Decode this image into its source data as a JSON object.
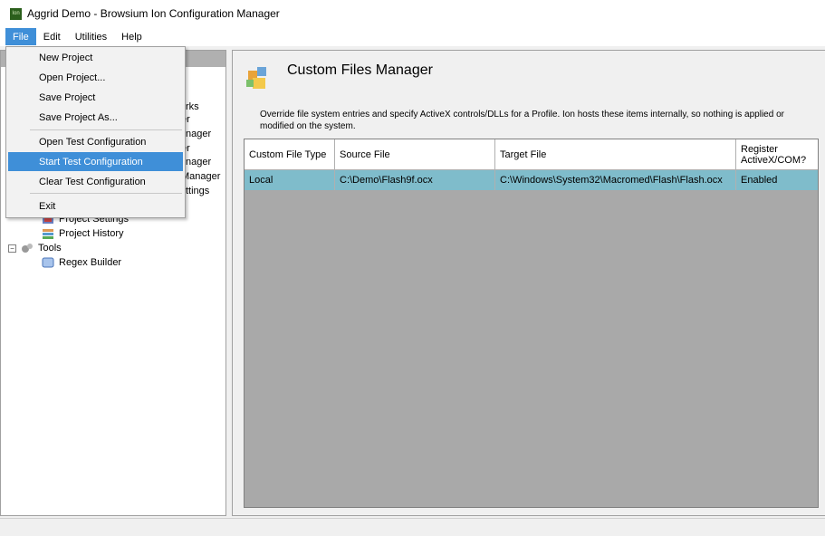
{
  "window": {
    "title": "Aggrid Demo - Browsium Ion Configuration Manager",
    "app_icon_text": "Ion"
  },
  "menubar": {
    "items": [
      "File",
      "Edit",
      "Utilities",
      "Help"
    ]
  },
  "file_menu": {
    "items": [
      "New Project",
      "Open Project...",
      "Save Project",
      "Save Project As...",
      "Open Test Configuration",
      "Start Test Configuration",
      "Clear Test Configuration",
      "Exit"
    ],
    "highlighted": "Start Test Configuration"
  },
  "tree": {
    "partial_labels": [
      "rks",
      "er",
      "nager",
      "er",
      "nager",
      "Manager",
      "ttings"
    ],
    "project_settings": "Project Settings",
    "project_history": "Project History",
    "tools": "Tools",
    "regex_builder": "Regex Builder"
  },
  "main": {
    "title": "Custom Files Manager",
    "description": "Override file system entries and specify ActiveX controls/DLLs for a Profile. Ion hosts these items internally, so nothing is applied or modified on the system.",
    "columns": [
      "Custom File Type",
      "Source File",
      "Target File",
      "Register ActiveX/COM?"
    ],
    "rows": [
      {
        "type": "Local",
        "source": "C:\\Demo\\Flash9f.ocx",
        "target": "C:\\Windows\\System32\\Macromed\\Flash\\Flash.ocx",
        "register": "Enabled"
      }
    ]
  },
  "colors": {
    "menu_highlight": "#3f8fd8",
    "selected_row": "#7fbccb",
    "grid_bg": "#a9a9a9"
  }
}
